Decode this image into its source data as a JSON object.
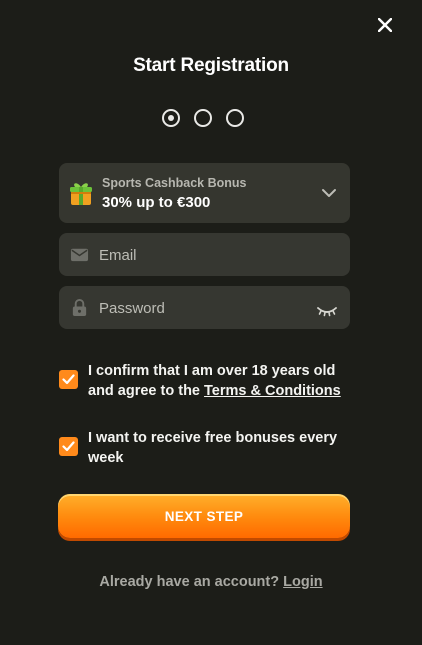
{
  "header": {
    "title": "Start Registration",
    "close_icon": "close-icon"
  },
  "steps": {
    "current": 1,
    "total": 3
  },
  "bonus": {
    "label": "Sports Cashback Bonus",
    "value": "30% up to €300",
    "icon": "gift-icon"
  },
  "form": {
    "email_placeholder": "Email",
    "password_placeholder": "Password"
  },
  "checkboxes": {
    "age_text": "I confirm that I am over 18 years old and agree to the ",
    "terms_link": "Terms & Conditions",
    "age_checked": true,
    "bonus_text": "I want to receive free bonuses every week",
    "bonus_checked": true
  },
  "next_button": "NEXT STEP",
  "footer": {
    "text": "Already have an account? ",
    "login_link": "Login"
  },
  "colors": {
    "background": "#1c1d18",
    "field": "#363731",
    "accent": "#ff8a1b"
  }
}
